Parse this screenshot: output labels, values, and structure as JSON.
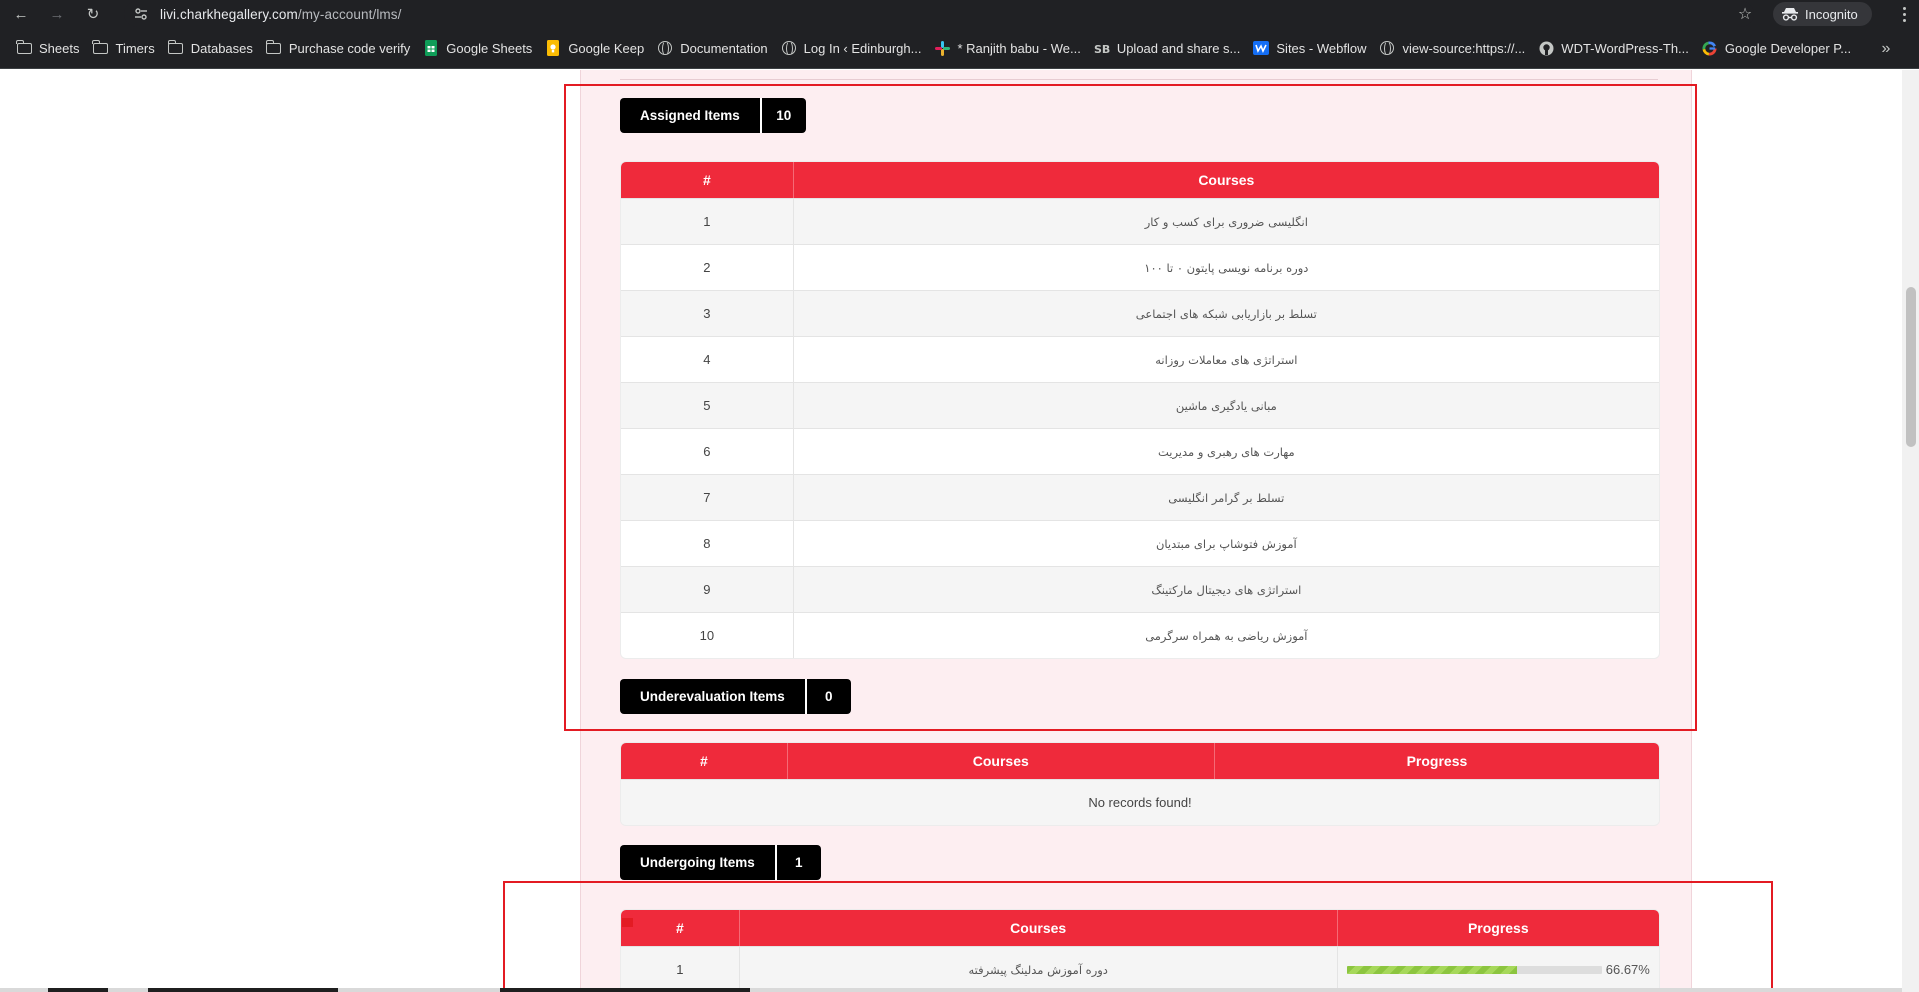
{
  "browser": {
    "url_host": "livi.charkhegallery.com",
    "url_path": "/my-account/lms/",
    "incognito_label": "Incognito",
    "bookmarks": [
      {
        "label": "Sheets",
        "icon": "folder-icon"
      },
      {
        "label": "Timers",
        "icon": "folder-icon"
      },
      {
        "label": "Databases",
        "icon": "folder-icon"
      },
      {
        "label": "Purchase code verify",
        "icon": "folder-icon"
      },
      {
        "label": "Google Sheets",
        "icon": "google-sheets-icon"
      },
      {
        "label": "Google Keep",
        "icon": "google-keep-icon"
      },
      {
        "label": "Documentation",
        "icon": "globe-icon"
      },
      {
        "label": "Log In ‹ Edinburgh...",
        "icon": "globe-icon"
      },
      {
        "label": "* Ranjith babu - We...",
        "icon": "slack-icon"
      },
      {
        "label": "Upload and share s...",
        "icon": "sb-icon"
      },
      {
        "label": "Sites - Webflow",
        "icon": "webflow-icon"
      },
      {
        "label": "view-source:https://...",
        "icon": "globe-icon"
      },
      {
        "label": "WDT-WordPress-Th...",
        "icon": "github-icon"
      },
      {
        "label": "Google Developer P...",
        "icon": "google-icon"
      }
    ]
  },
  "assigned": {
    "label": "Assigned Items",
    "count": "10",
    "headers": {
      "num": "#",
      "courses": "Courses"
    },
    "rows": [
      {
        "num": "1",
        "course": "انگلیسی ضروری برای کسب و کار"
      },
      {
        "num": "2",
        "course": "دوره برنامه نویسی پایتون ۰ تا ۱۰۰"
      },
      {
        "num": "3",
        "course": "تسلط بر بازاریابی شبکه های اجتماعی"
      },
      {
        "num": "4",
        "course": "استراتژی های معاملات روزانه"
      },
      {
        "num": "5",
        "course": "مبانی یادگیری ماشین"
      },
      {
        "num": "6",
        "course": "مهارت های رهبری و مدیریت"
      },
      {
        "num": "7",
        "course": "تسلط بر گرامر انگلیسی"
      },
      {
        "num": "8",
        "course": "آموزش فتوشاپ برای مبتدیان"
      },
      {
        "num": "9",
        "course": "استراتژی های دیجیتال مارکتینگ"
      },
      {
        "num": "10",
        "course": "آموزش ریاضی به همراه سرگرمی"
      }
    ]
  },
  "underevaluation": {
    "label": "Underevaluation Items",
    "count": "0",
    "headers": {
      "num": "#",
      "courses": "Courses",
      "progress": "Progress"
    },
    "empty_text": "No records found!"
  },
  "undergoing": {
    "label": "Undergoing Items",
    "count": "1",
    "headers": {
      "num": "#",
      "courses": "Courses",
      "progress": "Progress"
    },
    "rows": [
      {
        "num": "1",
        "course": "دوره آموزش مدلینگ پیشرفته",
        "progress_label": "66.67%",
        "progress_value": 66.67
      }
    ]
  },
  "colors": {
    "table_header": "#ef2a3b",
    "badge": "#000000",
    "panel_bg": "#fdeef1",
    "annotation": "#e31b23",
    "progress_fill": "#8cc53f"
  }
}
